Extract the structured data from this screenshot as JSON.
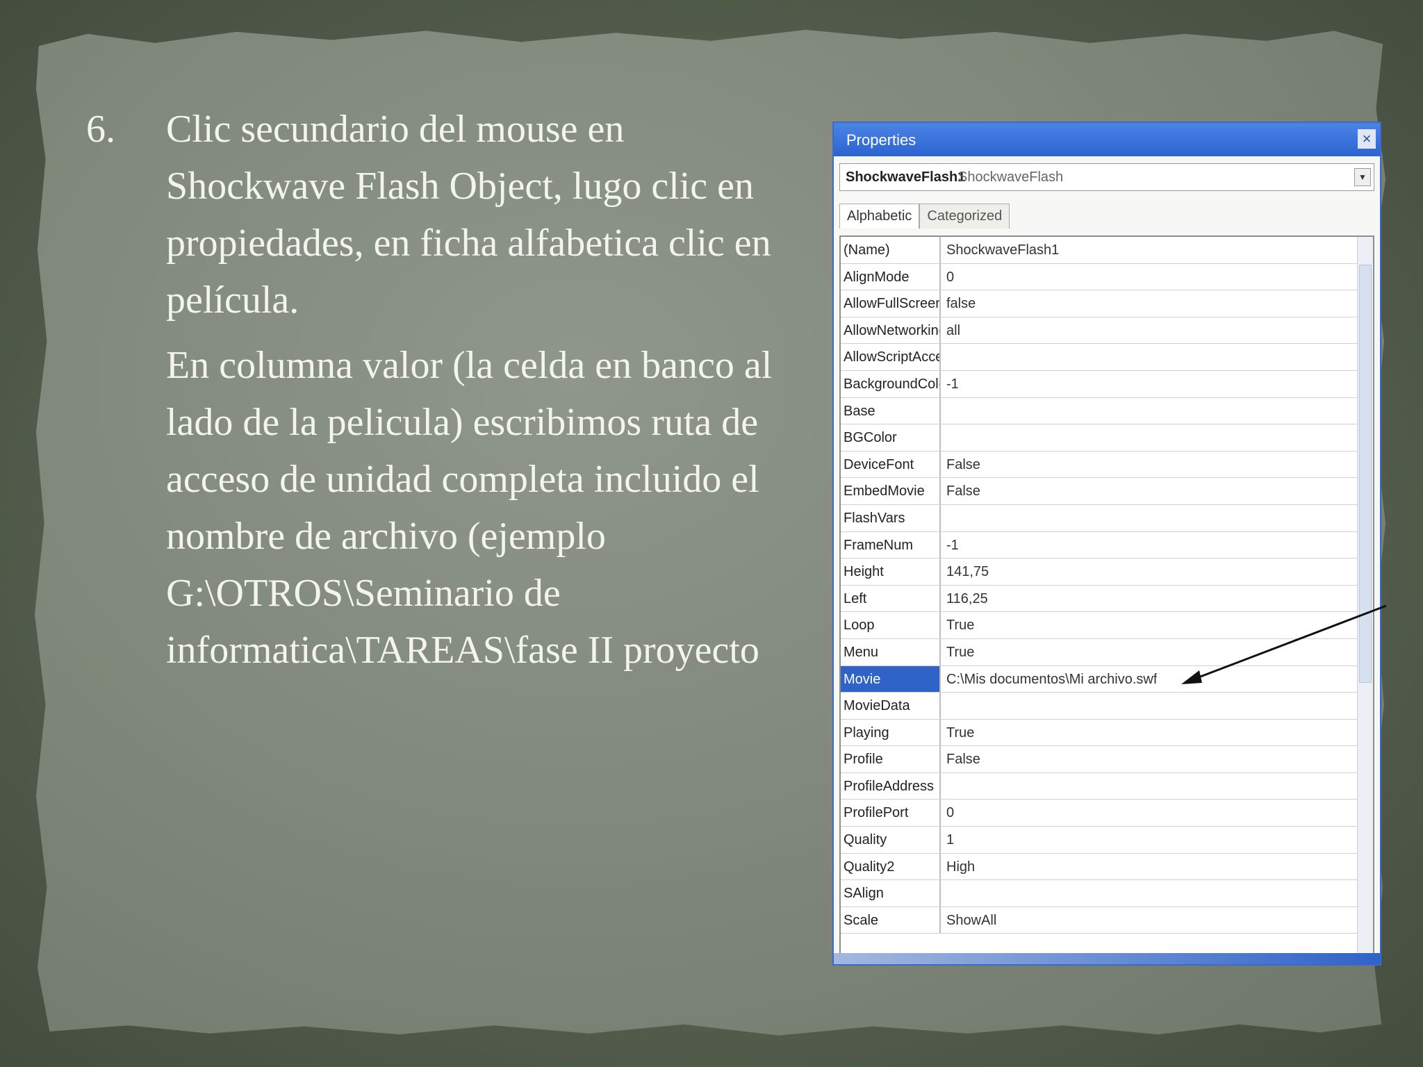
{
  "slide": {
    "number": "6.",
    "paragraphs": [
      "Clic secundario del mouse en Shockwave Flash Object, lugo clic en propiedades, en ficha alfabetica clic en película.",
      "En columna valor (la celda en banco al lado de la pelicula) escribimos ruta de acceso de unidad completa incluido el nombre de archivo (ejemplo G:\\OTROS\\Seminario de informatica\\TAREAS\\fase II proyecto"
    ]
  },
  "properties_window": {
    "title": "Properties",
    "close_glyph": "×",
    "object_name": "ShockwaveFlash1",
    "object_type": "ShockwaveFlash",
    "tabs": [
      "Alphabetic",
      "Categorized"
    ],
    "rows": [
      {
        "name": "(Name)",
        "value": "ShockwaveFlash1"
      },
      {
        "name": "AlignMode",
        "value": "0"
      },
      {
        "name": "AllowFullScreen",
        "value": "false"
      },
      {
        "name": "AllowNetworking",
        "value": "all"
      },
      {
        "name": "AllowScriptAccess",
        "value": ""
      },
      {
        "name": "BackgroundColor",
        "value": "-1"
      },
      {
        "name": "Base",
        "value": ""
      },
      {
        "name": "BGColor",
        "value": ""
      },
      {
        "name": "DeviceFont",
        "value": "False"
      },
      {
        "name": "EmbedMovie",
        "value": "False"
      },
      {
        "name": "FlashVars",
        "value": ""
      },
      {
        "name": "FrameNum",
        "value": "-1"
      },
      {
        "name": "Height",
        "value": "141,75"
      },
      {
        "name": "Left",
        "value": "116,25"
      },
      {
        "name": "Loop",
        "value": "True"
      },
      {
        "name": "Menu",
        "value": "True"
      },
      {
        "name": "Movie",
        "value": "C:\\Mis documentos\\Mi archivo.swf",
        "selected": true
      },
      {
        "name": "MovieData",
        "value": ""
      },
      {
        "name": "Playing",
        "value": "True"
      },
      {
        "name": "Profile",
        "value": "False"
      },
      {
        "name": "ProfileAddress",
        "value": ""
      },
      {
        "name": "ProfilePort",
        "value": "0"
      },
      {
        "name": "Quality",
        "value": "1"
      },
      {
        "name": "Quality2",
        "value": "High"
      },
      {
        "name": "SAlign",
        "value": ""
      },
      {
        "name": "Scale",
        "value": "ShowAll"
      }
    ]
  },
  "colors": {
    "background": "#56604f",
    "paper": "#80887b",
    "text": "#f4f4ef",
    "window_accent": "#2f63c8"
  }
}
